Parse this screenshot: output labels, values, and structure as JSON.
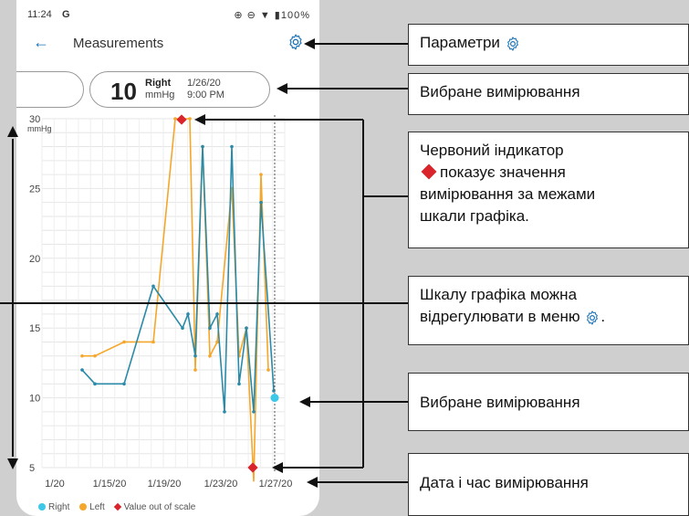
{
  "status_bar": {
    "time": "11:24",
    "icons": "⊕ ⊖ ▼ ▮100%",
    "g": "G"
  },
  "app_bar": {
    "title": "Measurements",
    "back_icon": "arrow-left-icon",
    "settings_icon": "gear-icon"
  },
  "selected_card": {
    "value": "10",
    "side": "Right",
    "unit": "mmHg",
    "date": "1/26/20",
    "time": "9:00 PM"
  },
  "chart_data": {
    "type": "line",
    "ylabel": "mmHg",
    "ylim": [
      5,
      30
    ],
    "yticks": [
      "30",
      "25",
      "20",
      "15",
      "10",
      "5"
    ],
    "xticks": [
      "1/20",
      "1/15/20",
      "1/19/20",
      "1/23/20",
      "1/27/20"
    ],
    "legend": [
      "Right",
      "Left",
      "Value out of scale"
    ],
    "colors": {
      "right": "#2b8aa8",
      "left": "#f4a72a",
      "out": "#d9242b",
      "selected": "#3cc8e8"
    },
    "series": [
      {
        "name": "Right",
        "values": [
          12,
          11,
          11,
          18,
          15,
          16,
          13,
          28,
          15,
          16,
          9,
          28,
          11,
          15,
          9,
          24,
          10.5
        ]
      },
      {
        "name": "Left",
        "values": [
          13,
          13,
          14,
          14,
          30,
          30,
          12,
          28,
          13,
          14,
          25,
          13,
          15,
          4,
          26,
          12
        ]
      }
    ],
    "selected_point": {
      "series": "Right",
      "value": 10
    }
  },
  "legend_labels": {
    "right": "Right",
    "left": "Left",
    "out": "Value out of scale"
  },
  "callouts": {
    "settings": "Параметри",
    "selected_top": "Вибране вимірювання",
    "red_indicator_1": "Червоний індикатор",
    "red_indicator_2": "показує значення",
    "red_indicator_3": "вимірювання за межами",
    "red_indicator_4": "шкали графіка.",
    "scale_1": "Шкалу графіка можна",
    "scale_2": "відрегулювати в меню",
    "selected_bottom": "Вибране вимірювання",
    "datetime": "Дата і час вимірювання"
  }
}
